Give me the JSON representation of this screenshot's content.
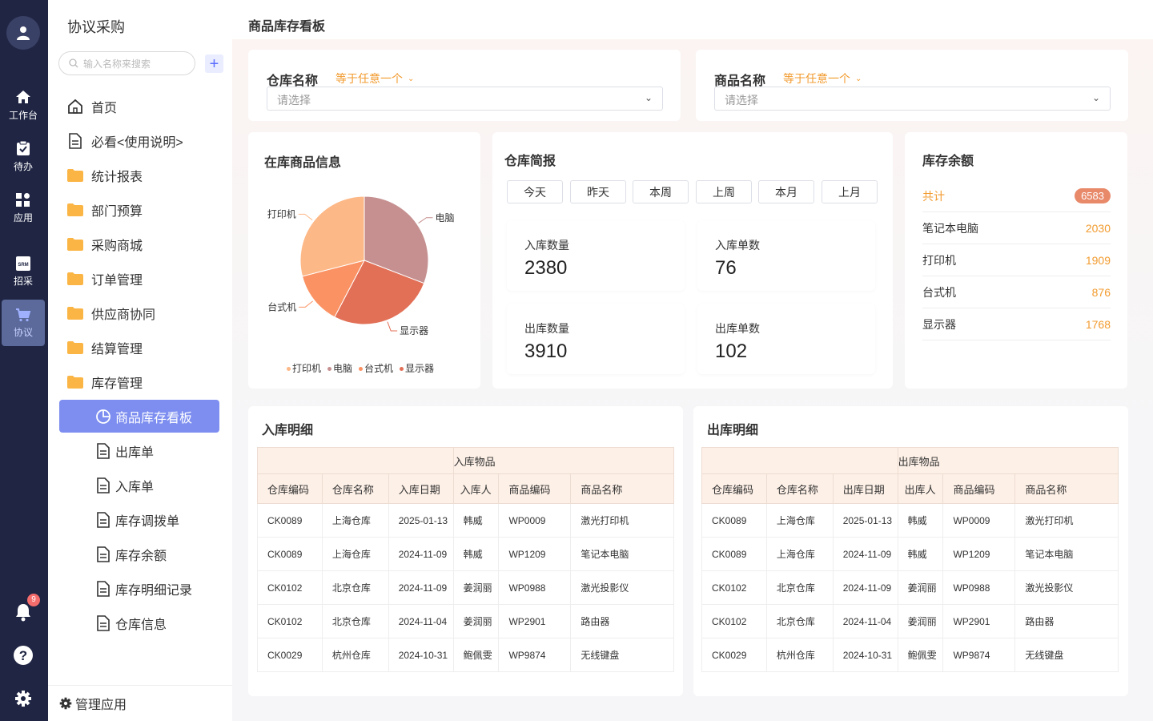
{
  "rail": {
    "items": [
      {
        "label": "工作台"
      },
      {
        "label": "待办"
      },
      {
        "label": "应用"
      },
      {
        "label": "招采"
      },
      {
        "label": "协议"
      }
    ],
    "notifications_count": "9"
  },
  "sidebar": {
    "title": "协议采购",
    "search_placeholder": "输入名称来搜索",
    "menu": [
      {
        "label": "首页"
      },
      {
        "label": "必看<使用说明>"
      },
      {
        "label": "统计报表"
      },
      {
        "label": "部门预算"
      },
      {
        "label": "采购商城"
      },
      {
        "label": "订单管理"
      },
      {
        "label": "供应商协同"
      },
      {
        "label": "结算管理"
      },
      {
        "label": "库存管理"
      }
    ],
    "submenu": [
      {
        "label": "商品库存看板"
      },
      {
        "label": "出库单"
      },
      {
        "label": "入库单"
      },
      {
        "label": "库存调拨单"
      },
      {
        "label": "库存余额"
      },
      {
        "label": "库存明细记录"
      },
      {
        "label": "仓库信息"
      }
    ],
    "manage_label": "管理应用"
  },
  "header": {
    "title": "商品库存看板"
  },
  "filters": [
    {
      "label": "仓库名称",
      "op": "等于任意一个",
      "placeholder": "请选择"
    },
    {
      "label": "商品名称",
      "op": "等于任意一个",
      "placeholder": "请选择"
    }
  ],
  "pie": {
    "title": "在库商品信息",
    "colors": {
      "打印机": "#fdb887",
      "电脑": "#c69090",
      "台式机": "#fb9263",
      "显示器": "#e27057"
    }
  },
  "warehouse": {
    "title": "仓库简报",
    "tabs": [
      "今天",
      "昨天",
      "本周",
      "上周",
      "本月",
      "上月"
    ],
    "stats": [
      {
        "label": "入库数量",
        "value": "2380"
      },
      {
        "label": "入库单数",
        "value": "76"
      },
      {
        "label": "出库数量",
        "value": "3910"
      },
      {
        "label": "出库单数",
        "value": "102"
      }
    ]
  },
  "balance": {
    "title": "库存余额",
    "total_label": "共计",
    "total_value": "6583",
    "rows": [
      {
        "name": "笔记本电脑",
        "value": "2030"
      },
      {
        "name": "打印机",
        "value": "1909"
      },
      {
        "name": "台式机",
        "value": "876"
      },
      {
        "name": "显示器",
        "value": "1768"
      }
    ]
  },
  "inbound": {
    "title": "入库明细",
    "group": "入库物品",
    "columns": [
      "仓库编码",
      "仓库名称",
      "入库日期",
      "入库人",
      "商品编码",
      "商品名称"
    ],
    "rows": [
      [
        "CK0089",
        "上海仓库",
        "2025-01-13",
        "韩威",
        "WP0009",
        "激光打印机"
      ],
      [
        "CK0089",
        "上海仓库",
        "2024-11-09",
        "韩威",
        "WP1209",
        "笔记本电脑"
      ],
      [
        "CK0102",
        "北京仓库",
        "2024-11-09",
        "姜润丽",
        "WP0988",
        "激光投影仪"
      ],
      [
        "CK0102",
        "北京仓库",
        "2024-11-04",
        "姜润丽",
        "WP2901",
        "路由器"
      ],
      [
        "CK0029",
        "杭州仓库",
        "2024-10-31",
        "鲍佩雯",
        "WP9874",
        "无线键盘"
      ]
    ]
  },
  "outbound": {
    "title": "出库明细",
    "group": "出库物品",
    "columns": [
      "仓库编码",
      "仓库名称",
      "出库日期",
      "出库人",
      "商品编码",
      "商品名称"
    ],
    "rows": [
      [
        "CK0089",
        "上海仓库",
        "2025-01-13",
        "韩威",
        "WP0009",
        "激光打印机"
      ],
      [
        "CK0089",
        "上海仓库",
        "2024-11-09",
        "韩威",
        "WP1209",
        "笔记本电脑"
      ],
      [
        "CK0102",
        "北京仓库",
        "2024-11-09",
        "姜润丽",
        "WP0988",
        "激光投影仪"
      ],
      [
        "CK0102",
        "北京仓库",
        "2024-11-04",
        "姜润丽",
        "WP2901",
        "路由器"
      ],
      [
        "CK0029",
        "杭州仓库",
        "2024-10-31",
        "鲍佩雯",
        "WP9874",
        "无线键盘"
      ]
    ]
  },
  "chart_data": {
    "type": "pie",
    "title": "在库商品信息",
    "categories": [
      "电脑",
      "显示器",
      "台式机",
      "打印机"
    ],
    "values": [
      2030,
      1768,
      876,
      1909
    ],
    "legend": [
      "打印机",
      "电脑",
      "台式机",
      "显示器"
    ],
    "legend_position": "bottom"
  }
}
